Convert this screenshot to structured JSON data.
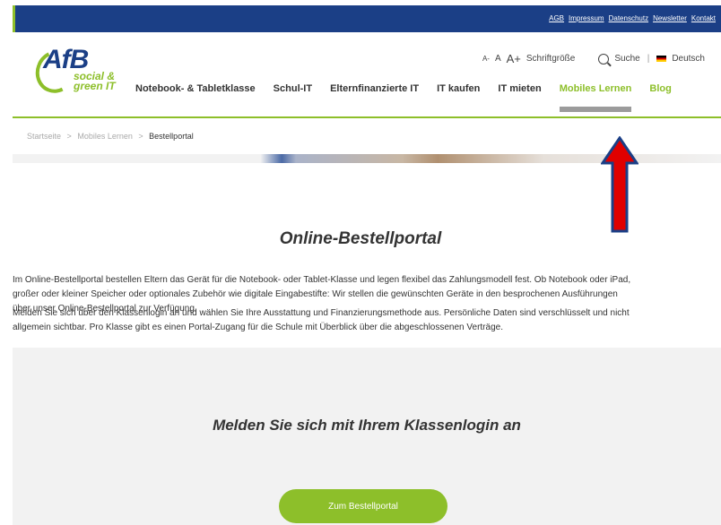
{
  "topbar": {
    "links": [
      "AGB",
      "Impressum",
      "Datenschutz",
      "Newsletter",
      "Kontakt"
    ]
  },
  "logo": {
    "main": "AfB",
    "line1": "social &",
    "line2": "green IT"
  },
  "util": {
    "font_small": "A-",
    "font_mid": "A",
    "font_large": "A+",
    "font_label": "Schriftgröße",
    "search_label": "Suche",
    "separator": "|",
    "language": "Deutsch"
  },
  "nav": {
    "items": [
      "Notebook- & Tabletklasse",
      "Schul-IT",
      "Elternfinanzierte IT",
      "IT kaufen",
      "IT mieten",
      "Mobiles Lernen",
      "Blog"
    ],
    "active": "Mobiles Lernen"
  },
  "breadcrumb": {
    "home": "Startseite",
    "parent": "Mobiles Lernen",
    "current": "Bestellportal",
    "sep": ">"
  },
  "main": {
    "title": "Online-Bestellportal",
    "paragraph1": [
      "Im Online-Bestellportal bestellen Eltern das Gerät für die Notebook- oder Tablet-Klasse und legen flexibel das Zahlungsmodell fest. Ob Notebook oder iPad,",
      "großer oder kleiner Speicher oder optionales Zubehör wie digitale Eingabestifte: Wir stellen die gewünschten Geräte in den besprochenen Ausführungen",
      "über unser Online-Bestellportal zur Verfügung."
    ],
    "paragraph2": [
      "Melden Sie sich über den Klassenlogin an und wählen Sie Ihre Ausstattung und Finanzierungsmethode aus. Persönliche Daten sind verschlüsselt und nicht",
      "allgemein sichtbar. Pro Klasse gibt es einen Portal-Zugang für die Schule mit Überblick über die abgeschlossenen Verträge."
    ]
  },
  "login": {
    "title": "Melden Sie sich mit Ihrem Klassenlogin an",
    "button": "Zum Bestellportal"
  },
  "colors": {
    "brand_blue": "#1b3f86",
    "brand_green": "#8dbf2a",
    "arrow_red": "#e00000",
    "arrow_outline": "#1b3f86"
  }
}
